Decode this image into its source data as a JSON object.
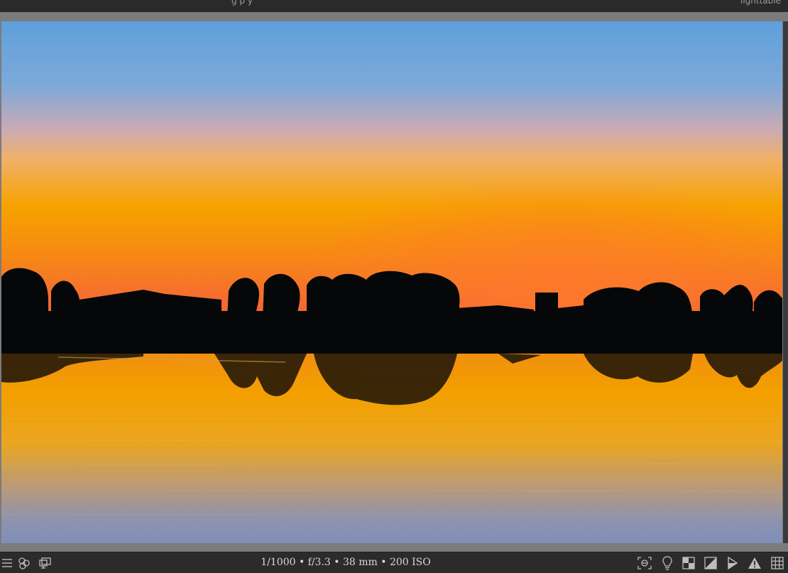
{
  "topbar": {
    "left_text": "g   p   y",
    "right_text": "lighttable"
  },
  "photo": {
    "sky_top_color": "#5e9fdc",
    "horizon_color": "#f7a200",
    "silhouette_color": "#060708"
  },
  "bottombar": {
    "exif": "1/1000 • f/3.3 • 38 mm • 200 ISO",
    "left_icons": [
      "menu-icon",
      "color-circles-icon",
      "display-icon"
    ],
    "right_icons": [
      "focus-peaking-icon",
      "bulb-icon",
      "checkerboard-icon",
      "contrast-icon",
      "guide-triangle-icon",
      "warning-icon",
      "grid-icon"
    ]
  }
}
